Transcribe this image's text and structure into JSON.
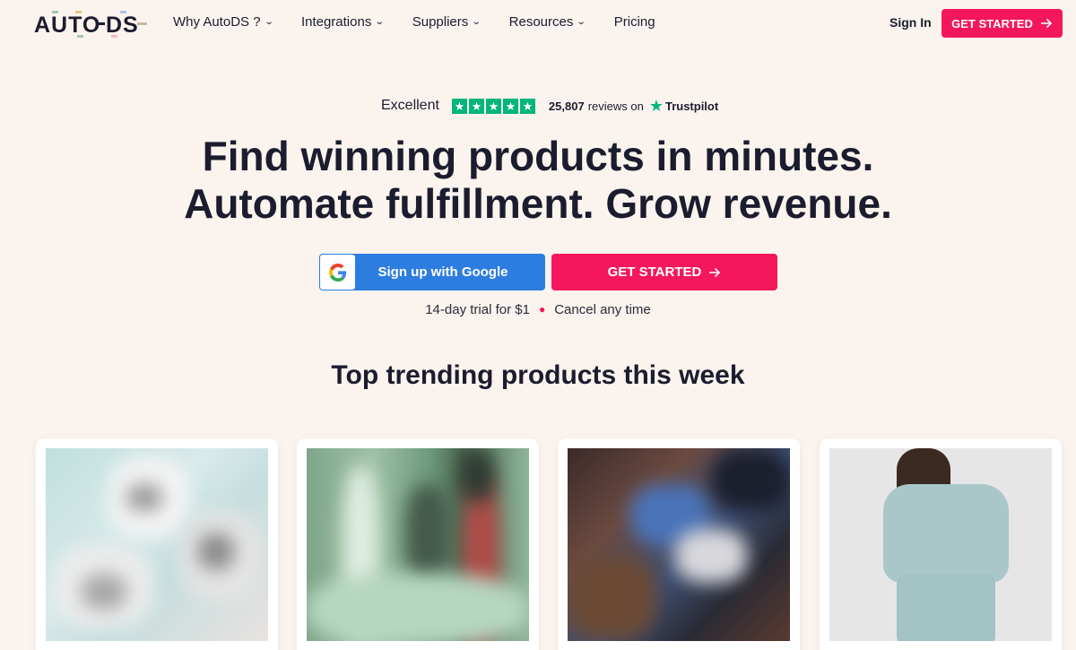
{
  "nav": {
    "logo_text": "AUTO-DS",
    "links": [
      {
        "label": "Why AutoDS ?",
        "dropdown": true
      },
      {
        "label": "Integrations",
        "dropdown": true
      },
      {
        "label": "Suppliers",
        "dropdown": true
      },
      {
        "label": "Resources",
        "dropdown": true
      },
      {
        "label": "Pricing",
        "dropdown": false
      }
    ],
    "sign_in": "Sign In",
    "cta": "GET STARTED"
  },
  "trustpilot": {
    "rating_word": "Excellent",
    "stars": 5,
    "review_count": "25,807",
    "reviews_on": "reviews on",
    "brand": "Trustpilot"
  },
  "hero": {
    "headline_line1": "Find winning products in minutes.",
    "headline_line2": "Automate fulfillment. Grow revenue.",
    "google_button": "Sign up with Google",
    "start_button": "GET STARTED",
    "trial_text": "14-day trial for $1",
    "cancel_text": "Cancel any time"
  },
  "trending": {
    "title": "Top trending products this week",
    "cards": 4
  },
  "colors": {
    "accent": "#f5175e",
    "google_blue": "#2d7de0",
    "trustpilot_green": "#00b67a",
    "background": "#fbf3ee",
    "text": "#1b1d2e"
  },
  "icons": {
    "arrow": "arrow-right-icon",
    "chevron": "chevron-down-icon",
    "google": "google-g-icon",
    "star": "star-icon"
  }
}
